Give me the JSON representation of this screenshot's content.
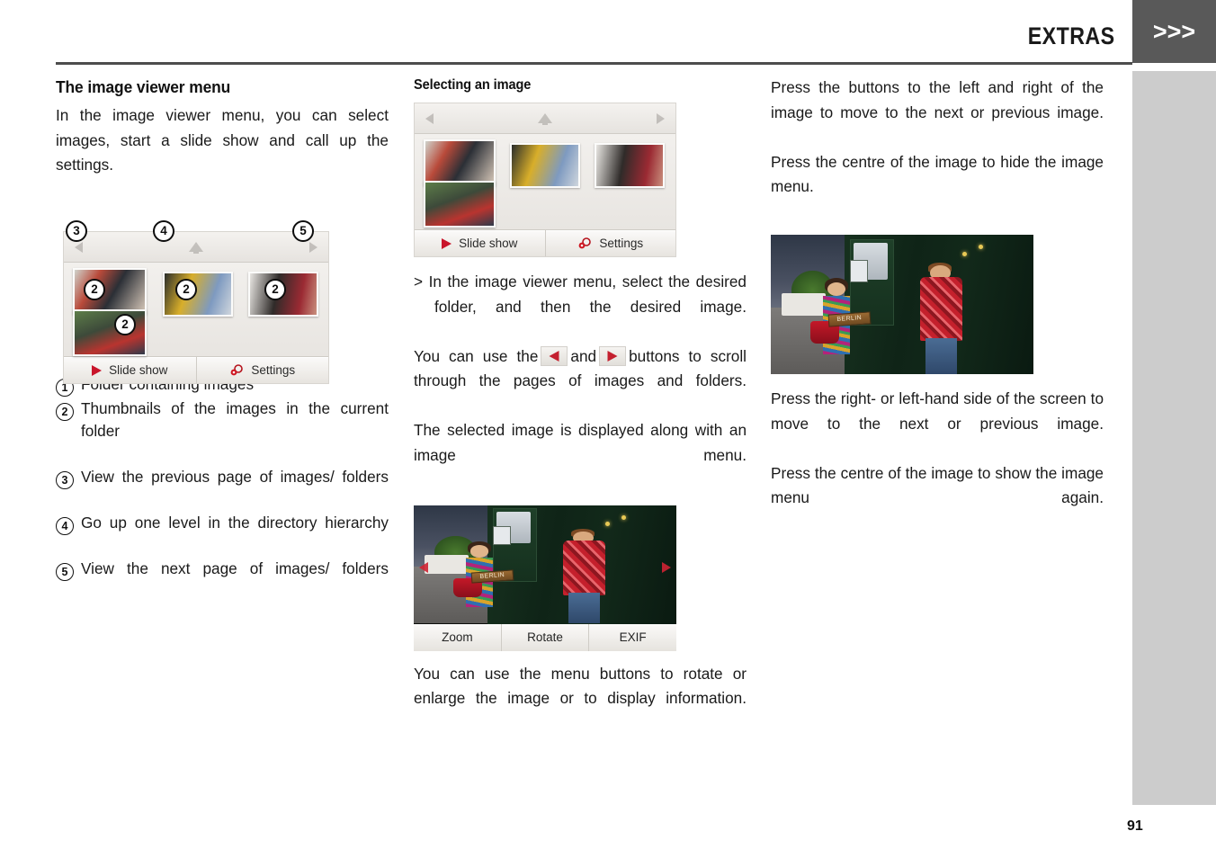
{
  "header": {
    "title": "EXTRAS",
    "chevrons": ">>>",
    "page_number": "91"
  },
  "left_column": {
    "heading": "The image viewer menu",
    "intro": "In the image viewer menu, you can select images, start a slide show and call up the settings.",
    "device": {
      "slide_show_label": "Slide show",
      "settings_label": "Settings",
      "callouts": [
        "3",
        "4",
        "5",
        "2",
        "2",
        "2",
        "2"
      ]
    },
    "legend": [
      {
        "num": "1",
        "text": "Folder containing images"
      },
      {
        "num": "2",
        "text": "Thumbnails of the images in the current folder"
      },
      {
        "num": "3",
        "text": "View the previous page of images/ folders"
      },
      {
        "num": "4",
        "text": "Go up one level in the directory hierarchy"
      },
      {
        "num": "5",
        "text": "View the next page of images/ folders"
      }
    ]
  },
  "middle_column": {
    "heading": "Selecting an image",
    "device": {
      "slide_show_label": "Slide show",
      "settings_label": "Settings"
    },
    "step": "> In the image viewer menu, select the desired folder, and then the desired image.",
    "para_scroll_before": "You can use the",
    "para_scroll_and": "and",
    "para_scroll_after": "buttons to scroll through the pages of images and folders.",
    "para_selected": "The selected image is displayed along with an image menu.",
    "photo": {
      "sign_text": "BERLIN",
      "menu": [
        "Zoom",
        "Rotate",
        "EXIF"
      ]
    },
    "para_menu_buttons": "You can use the menu buttons to rotate or enlarge the image or to display information."
  },
  "right_column": {
    "para_1": "Press the buttons to the left and right of the image to move to the next or previous image.",
    "para_2": "Press the centre of the image to hide the image menu.",
    "photo": {
      "sign_text": "BERLIN"
    },
    "para_3": "Press the right- or left-hand side of the screen to move to the next or previous image.",
    "para_4": "Press the centre of the image to show the image menu again."
  },
  "colors": {
    "header_band": "#595959",
    "side_band": "#cccccc",
    "rule": "#4d4d4d",
    "accent_red": "#c4202f"
  }
}
